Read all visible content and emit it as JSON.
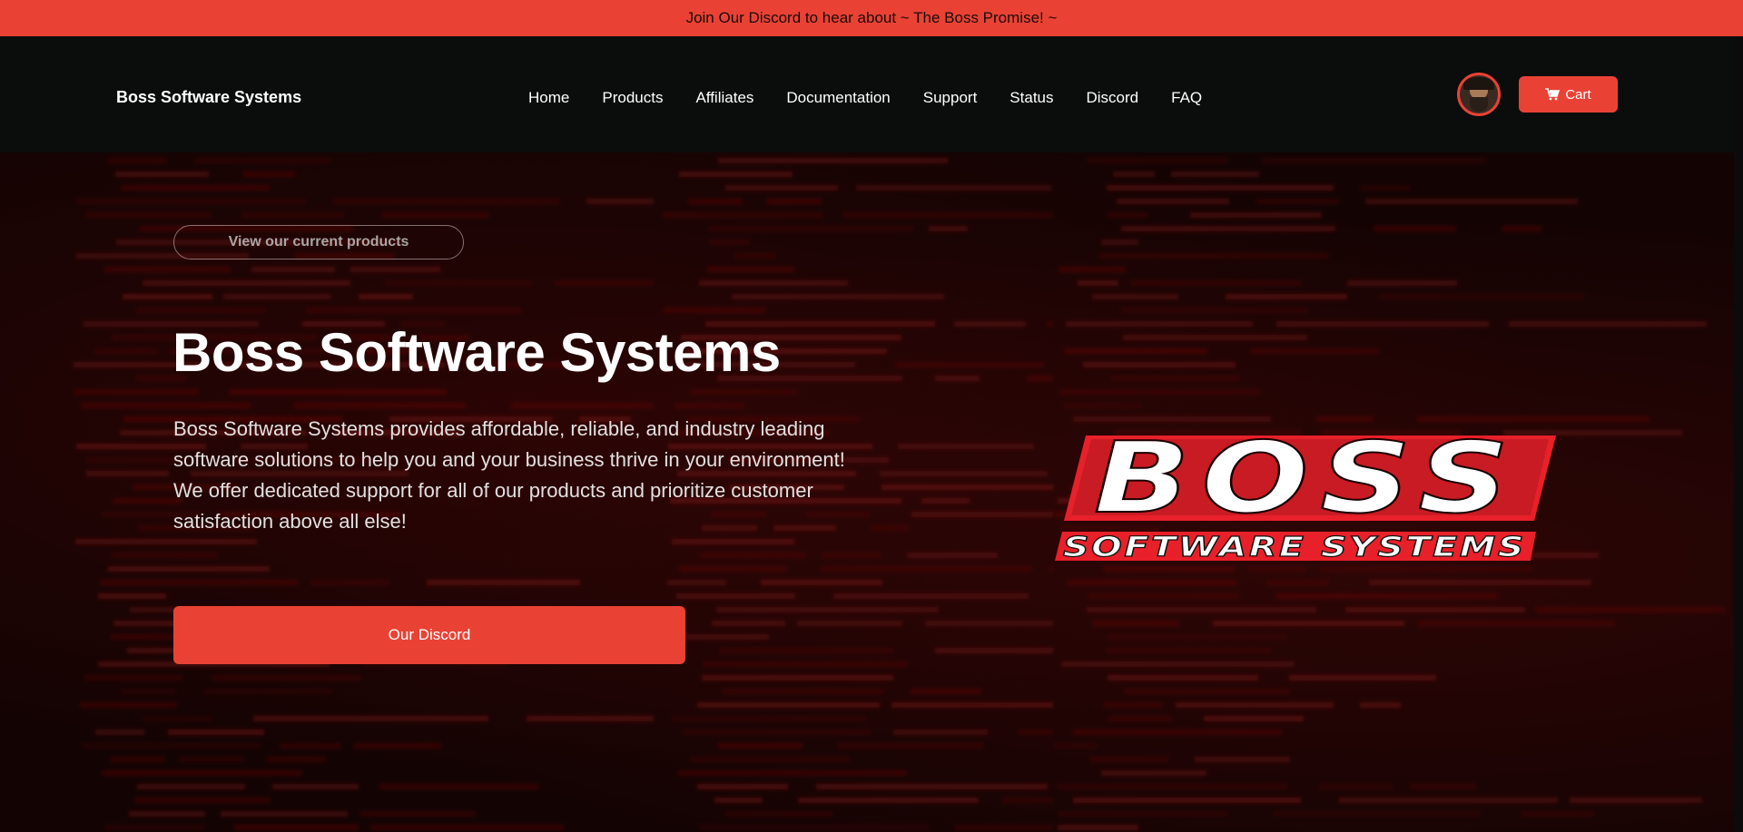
{
  "announcement": {
    "text": "Join Our Discord to hear about ~ The Boss Promise! ~"
  },
  "header": {
    "brand": "Boss Software Systems",
    "nav": [
      {
        "label": "Home"
      },
      {
        "label": "Products"
      },
      {
        "label": "Affiliates"
      },
      {
        "label": "Documentation"
      },
      {
        "label": "Support"
      },
      {
        "label": "Status"
      },
      {
        "label": "Discord"
      },
      {
        "label": "FAQ"
      }
    ],
    "cart_label": "Cart"
  },
  "hero": {
    "products_button": "View our current products",
    "title": "Boss Software Systems",
    "description": "Boss Software Systems provides affordable, reliable, and industry leading software solutions to help you and your business thrive in your environment! We offer dedicated support for all of our products and prioritize customer satisfaction above all else!",
    "discord_button": "Our Discord",
    "logo": {
      "word": "BOSS",
      "subtitle": "SOFTWARE SYSTEMS"
    }
  },
  "colors": {
    "accent": "#e94235",
    "header_bg": "#0b0c0c",
    "hero_bg": "#140303"
  },
  "icons": {
    "cart": "cart-icon",
    "avatar": "user-avatar"
  }
}
